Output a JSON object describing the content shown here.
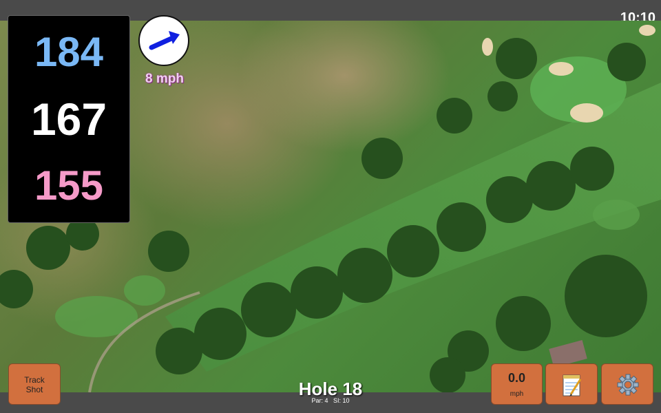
{
  "status": {
    "time": "10:10"
  },
  "yardages": {
    "back": "184",
    "middle": "167",
    "front": "155"
  },
  "wind": {
    "speed_label": "8 mph",
    "direction_icon": "arrow-icon",
    "arrow_color": "#1020e0"
  },
  "hole": {
    "title": "Hole 18",
    "par": "Par: 4",
    "stroke_index": "SI: 10"
  },
  "controls": {
    "track_shot_line1": "Track",
    "track_shot_line2": "Shot",
    "speed_value": "0.0",
    "speed_unit": "mph",
    "notes_icon": "notepad-icon",
    "settings_icon": "gear-icon"
  },
  "colors": {
    "back_yardage": "#7ab8f5",
    "middle_yardage": "#ffffff",
    "front_yardage": "#f59ac8",
    "button": "#d2703e"
  }
}
